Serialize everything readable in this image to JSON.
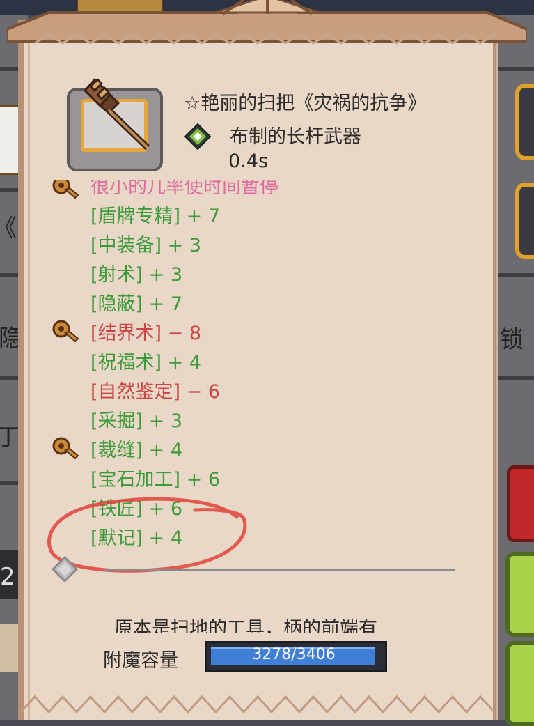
{
  "background": {
    "left_glyphs": [
      "《",
      "隐",
      "丁"
    ],
    "right_glyphs": [
      "锁"
    ],
    "left_number": "2"
  },
  "item": {
    "title": "☆艳丽的扫把《灾祸的抗争》",
    "type": "布制的长杆武器",
    "speed": "0.4s",
    "icon": "broom-icon",
    "type_icon": "green-gem-icon"
  },
  "stats": {
    "partial_line": "很小的几率使时间暂停",
    "lines": [
      {
        "text": "[盾牌专精] + 7",
        "color": "green",
        "key": false
      },
      {
        "text": "[中装备] + 3",
        "color": "green",
        "key": false
      },
      {
        "text": "[射术] + 3",
        "color": "green",
        "key": false
      },
      {
        "text": "[隐蔽] + 7",
        "color": "green",
        "key": false
      },
      {
        "text": "[结界术] − 8",
        "color": "red",
        "key": true
      },
      {
        "text": "[祝福术] + 4",
        "color": "green",
        "key": false
      },
      {
        "text": "[自然鉴定] − 6",
        "color": "red",
        "key": false
      },
      {
        "text": "[采掘] + 3",
        "color": "green",
        "key": false
      },
      {
        "text": "[裁缝] + 4",
        "color": "green",
        "key": true
      },
      {
        "text": "[宝石加工] + 6",
        "color": "green",
        "key": false
      },
      {
        "text": "[铁匠] + 6",
        "color": "green",
        "key": false
      },
      {
        "text": "[默记] + 4",
        "color": "green",
        "key": false
      }
    ]
  },
  "description": {
    "text": "原本是扫地的工具，柄的前端有"
  },
  "enchant": {
    "label": "附魔容量",
    "current": 3278,
    "max": 3406,
    "display": "3278/3406"
  },
  "colors": {
    "panel": "#e9d8c8",
    "green_text": "#3c9b38",
    "red_text": "#cc4444",
    "pink_text": "#e06b9e",
    "bar_fill": "#3f7fd6"
  }
}
